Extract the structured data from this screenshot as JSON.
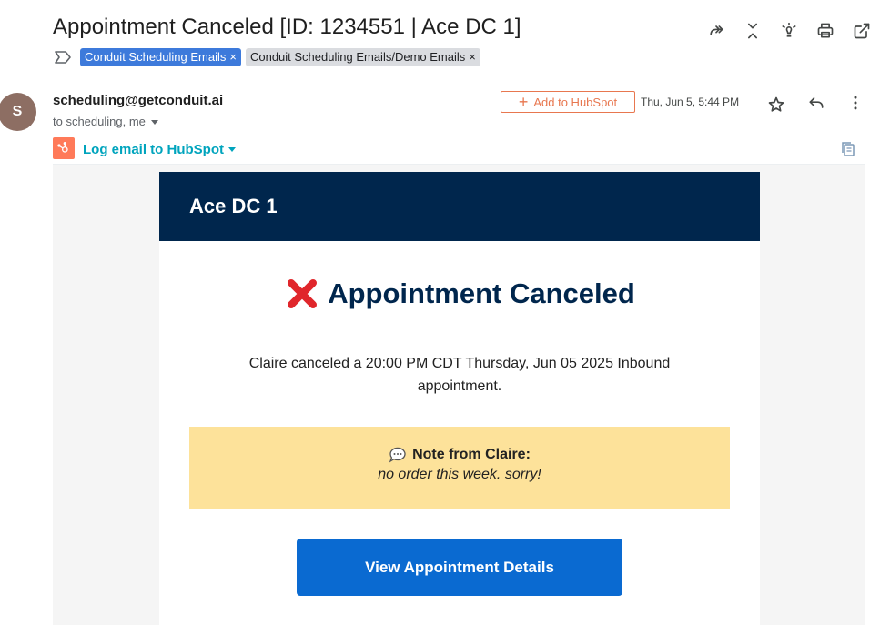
{
  "email": {
    "subject": "Appointment Canceled [ID: 1234551 | Ace DC 1]",
    "labels": [
      {
        "text": "Conduit Scheduling Emails",
        "remove": "×"
      },
      {
        "text": "Conduit Scheduling Emails/Demo Emails",
        "remove": "×"
      }
    ],
    "sender_initial": "S",
    "sender_email": "scheduling@getconduit.ai",
    "recipients": "to scheduling, me",
    "hubspot_button": "Add to HubSpot",
    "hubspot_plus": "+",
    "date": "Thu, Jun 5, 5:44 PM",
    "log_hubspot": "Log email to HubSpot"
  },
  "content": {
    "banner_title": "Ace DC 1",
    "heading": "Appointment Canceled",
    "message": "Claire canceled a 20:00 PM CDT Thursday, Jun 05 2025 Inbound appointment.",
    "note_title": "Note from Claire:",
    "note_body": "no order this week. sorry!",
    "cta_label": "View Appointment Details"
  },
  "icons": {
    "top": [
      "reply-all-arrow-icon",
      "collapse-icon",
      "lightbulb-icon",
      "print-icon",
      "open-in-new-window-icon"
    ],
    "header": [
      "star-icon",
      "reply-icon",
      "more-vert-icon"
    ]
  },
  "colors": {
    "banner": "#00264d",
    "heading": "#00264d",
    "note_bg": "#fde29a",
    "cta": "#0a6ad1",
    "hubspot": "#ff7a59",
    "hubspot_link": "#00a4bd",
    "label_blue": "#3d7adb",
    "avatar": "#8d6e63"
  }
}
